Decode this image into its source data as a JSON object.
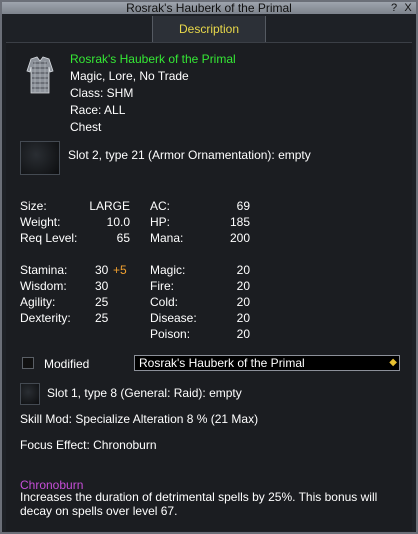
{
  "window": {
    "title": "Rosrak's Hauberk of the Primal",
    "help_button": "?",
    "close_button": "X",
    "tab_label": "Description"
  },
  "item": {
    "name": "Rosrak's Hauberk of the Primal",
    "flags": "Magic, Lore, No Trade",
    "class": "Class: SHM",
    "race": "Race: ALL",
    "slot": "Chest"
  },
  "ornament_slot": "Slot 2, type 21 (Armor Ornamentation): empty",
  "stats_left": [
    {
      "label": "Size:",
      "value": "LARGE"
    },
    {
      "label": "Weight:",
      "value": "10.0"
    },
    {
      "label": "Req Level:",
      "value": "65"
    }
  ],
  "stats_right": [
    {
      "label": "AC:",
      "value": "69"
    },
    {
      "label": "HP:",
      "value": "185"
    },
    {
      "label": "Mana:",
      "value": "200"
    }
  ],
  "attributes": [
    {
      "label": "Stamina:",
      "value": "30",
      "bonus": "+5"
    },
    {
      "label": "Wisdom:",
      "value": "30",
      "bonus": ""
    },
    {
      "label": "Agility:",
      "value": "25",
      "bonus": ""
    },
    {
      "label": "Dexterity:",
      "value": "25",
      "bonus": ""
    }
  ],
  "resists": [
    {
      "label": "Magic:",
      "value": "20"
    },
    {
      "label": "Fire:",
      "value": "20"
    },
    {
      "label": "Cold:",
      "value": "20"
    },
    {
      "label": "Disease:",
      "value": "20"
    },
    {
      "label": "Poison:",
      "value": "20"
    }
  ],
  "modified": {
    "label": "Modified",
    "checked": false,
    "dropdown_value": "Rosrak's Hauberk of the Primal"
  },
  "aug_slot": "Slot 1, type 8 (General: Raid): empty",
  "skill_mod": "Skill Mod: Specialize Alteration 8 % (21 Max)",
  "focus_effect": "Focus Effect: Chronoburn",
  "focus_name": "Chronoburn",
  "focus_desc_line1": "Increases the duration of detrimental spells by 25%. This bonus will",
  "focus_desc_line2": "decay on spells over level 67.",
  "colors": {
    "name_green": "#35e835",
    "bonus_orange": "#f0a030",
    "focus_purple": "#c64ed8",
    "tab_yellow": "#e8d84a"
  },
  "icons": [
    "chainmail-hauberk-icon",
    "empty-slot-icon",
    "dropdown-arrow-icon"
  ]
}
